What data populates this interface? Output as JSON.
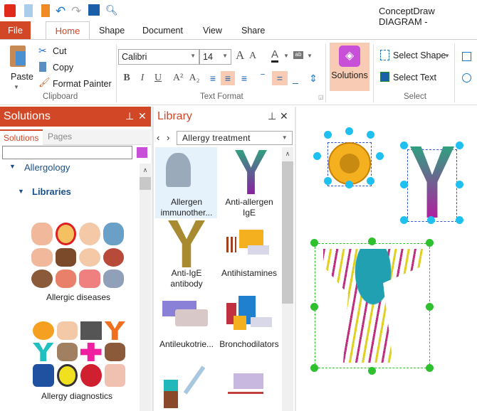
{
  "app": {
    "title": "ConceptDraw DIAGRAM -"
  },
  "menu_tabs": {
    "file": "File",
    "home": "Home",
    "shape": "Shape",
    "document": "Document",
    "view": "View",
    "share": "Share"
  },
  "ribbon": {
    "clipboard": {
      "paste": "Paste",
      "cut": "Cut",
      "copy": "Copy",
      "format_painter": "Format Painter",
      "group": "Clipboard"
    },
    "text_format": {
      "font": "Calibri",
      "size": "14",
      "group": "Text Format",
      "bold": "B",
      "italic": "I",
      "underline": "U"
    },
    "solutions": "Solutions",
    "select": {
      "select_shape": "Select Shape",
      "select_text": "Select Text",
      "group": "Select"
    }
  },
  "solutions_panel": {
    "title": "Solutions",
    "tabs": [
      "Solutions",
      "Pages"
    ],
    "search_value": "",
    "tree": {
      "root": "Allergology",
      "child": "Libraries"
    },
    "libraries": [
      "Allergic diseases",
      "Allergy diagnostics"
    ]
  },
  "library_panel": {
    "title": "Library",
    "selected": "Allergy treatment",
    "items": [
      "Allergen immunother...",
      "Anti-allergen IgE",
      "Anti-IgE antibody",
      "Antihistamines",
      "Antileukotrie...",
      "Bronchodilators"
    ]
  },
  "colors": {
    "accent": "#d24726",
    "selection": "#f8cbb4",
    "handle": "#1ec0f0",
    "handle_green": "#2ec02e"
  }
}
